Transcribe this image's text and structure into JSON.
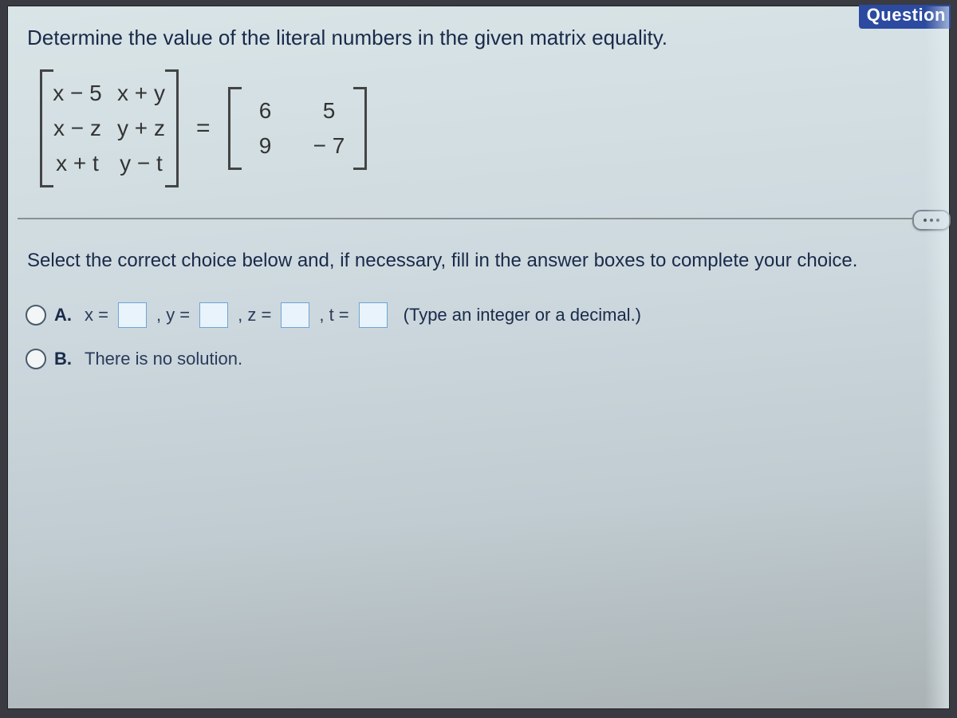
{
  "header_fragment": "Question",
  "prompt": "Determine the value of the literal numbers in the given matrix equality.",
  "matrix_left": {
    "rows": [
      [
        "x − 5",
        "x + y"
      ],
      [
        "x − z",
        "y + z"
      ],
      [
        "x + t",
        "y − t"
      ]
    ]
  },
  "equals": "=",
  "matrix_right": {
    "rows": [
      [
        "6",
        "5"
      ],
      [
        "9",
        "− 7"
      ]
    ]
  },
  "instruction": "Select the correct choice below and, if necessary, fill in the answer boxes to complete your choice.",
  "choices": {
    "A": {
      "label": "A.",
      "parts": {
        "x_prefix": "x =",
        "sep_xy": ", y =",
        "sep_yz": ", z =",
        "sep_zt": ", t ="
      },
      "hint": "(Type an integer or a decimal.)"
    },
    "B": {
      "label": "B.",
      "text": "There is no solution."
    }
  }
}
